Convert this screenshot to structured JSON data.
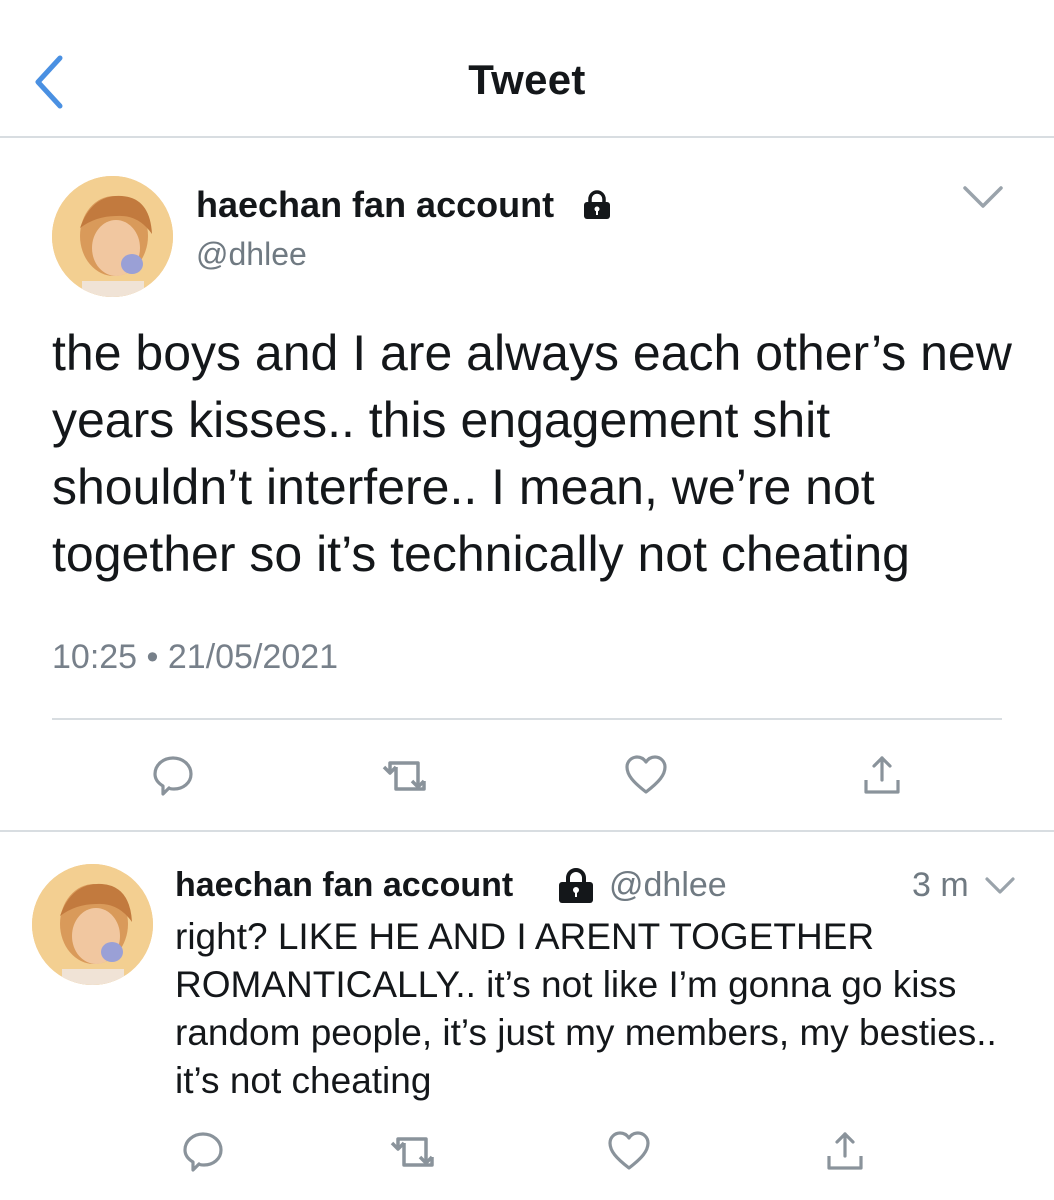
{
  "header": {
    "title": "Tweet"
  },
  "tweet": {
    "display_name": "haechan fan account",
    "handle": "@dhlee",
    "text": "the boys and I are always each other’s new years kisses.. this engagement shit shouldn’t interfere.. I mean, we’re not together so it’s technically not cheating",
    "timestamp": "10:25 • 21/05/2021"
  },
  "reply": {
    "display_name": "haechan fan account",
    "handle": "@dhlee",
    "age": "3 m",
    "text": "right? LIKE HE AND I ARENT TOGETHER ROMANTICALLY.. it’s not like I’m gonna go kiss random people, it’s just my members, my besties.. it’s not cheating"
  },
  "colors": {
    "accent": "#4a90e2",
    "icon_gray": "#8a939b",
    "divider": "#d8dde1"
  },
  "icons": [
    "chevron-left-icon",
    "lock-icon",
    "chevron-down-icon",
    "reply-icon",
    "retweet-icon",
    "heart-icon",
    "share-icon"
  ]
}
